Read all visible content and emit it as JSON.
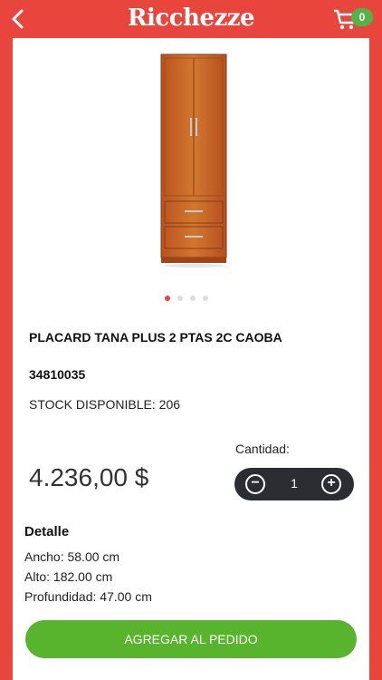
{
  "header": {
    "logo_text": "Ricchezze",
    "cart_count": "0",
    "back_icon": "chevron-left-icon",
    "cart_icon": "cart-icon"
  },
  "product": {
    "name": "PLACARD TANA PLUS 2 PTAS 2C CAOBA",
    "code": "34810035",
    "stock_label": "STOCK DISPONIBLE: 206",
    "price": "4.236,00 $",
    "image_slides": 4,
    "active_slide": 1
  },
  "quantity": {
    "label": "Cantidad:",
    "value": "1",
    "minus_icon": "minus-circle-icon",
    "plus_icon": "plus-circle-icon"
  },
  "detail": {
    "title": "Detalle",
    "width": "Ancho: 58.00 cm",
    "height": "Alto: 182.00 cm",
    "depth": "Profundidad: 47.00 cm"
  },
  "actions": {
    "add_label": "AGREGAR AL PEDIDO"
  },
  "colors": {
    "brand_red": "#e8453c",
    "green": "#58b32d",
    "stepper_bg": "#2b2d33"
  }
}
